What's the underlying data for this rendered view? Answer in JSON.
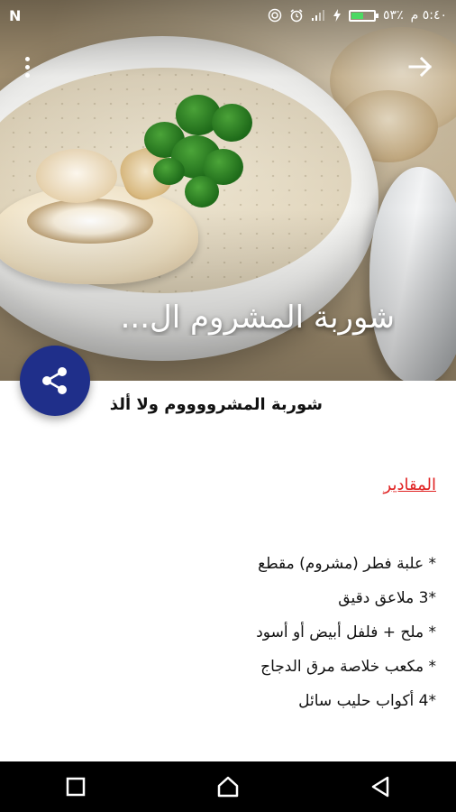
{
  "status_bar": {
    "left_indicator": "N",
    "time": "٥:٤٠ م",
    "battery_text": "٥٣٪",
    "battery_level": 0.53,
    "icons": [
      "nfc-icon",
      "alarm-icon",
      "signal-icon",
      "charging-icon",
      "battery-icon"
    ]
  },
  "header": {
    "title": "شوربة المشروم ال...",
    "menu_icon": "more-vert-icon",
    "forward_icon": "arrow-forward-icon"
  },
  "fab": {
    "icon": "share-icon",
    "color": "#1f2f8a"
  },
  "article": {
    "subtitle": "شوربة المشرووووم ولا ألذ",
    "section_heading": "المقادير",
    "section_heading_color": "#e02020",
    "ingredients": [
      "* علبة فطر (مشروم) مقطع",
      "*3 ملاعق دقيق",
      "* ملح + فلفل أبيض أو أسود",
      "* مكعب خلاصة مرق الدجاج",
      "*4 أكواب حليب سائل"
    ]
  },
  "nav_bar": {
    "buttons": [
      "recents-square-icon",
      "home-icon",
      "back-triangle-icon"
    ]
  }
}
